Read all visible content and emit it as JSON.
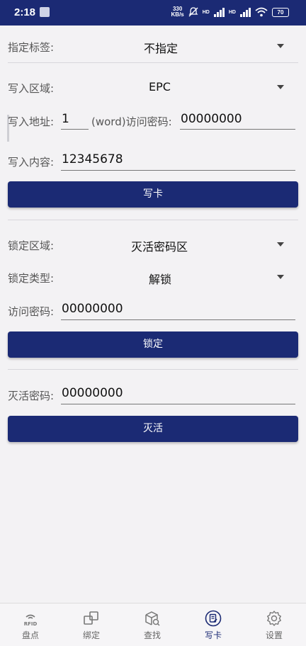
{
  "status": {
    "time": "2:18",
    "speed_top": "330",
    "speed_bottom": "KB/s",
    "network_1": "HD",
    "network_2": "HD",
    "battery": "70"
  },
  "write": {
    "tag_label": "指定标签:",
    "tag_value": "不指定",
    "area_label": "写入区域:",
    "area_value": "EPC",
    "address_label": "写入地址:",
    "address_value": "1",
    "word_label": "(word)访问密码:",
    "password_value": "00000000",
    "content_label": "写入内容:",
    "content_value": "12345678",
    "button": "写卡"
  },
  "lock": {
    "area_label": "锁定区域:",
    "area_value": "灭活密码区",
    "type_label": "锁定类型:",
    "type_value": "解锁",
    "password_label": "访问密码:",
    "password_value": "00000000",
    "button": "锁定"
  },
  "kill": {
    "password_label": "灭活密码:",
    "password_value": "00000000",
    "button": "灭活"
  },
  "nav": {
    "items": [
      {
        "label": "盘点",
        "icon": "rfid-icon",
        "icon_text": "RFID"
      },
      {
        "label": "绑定",
        "icon": "bind-icon"
      },
      {
        "label": "查找",
        "icon": "search-box-icon"
      },
      {
        "label": "写卡",
        "icon": "write-card-icon"
      },
      {
        "label": "设置",
        "icon": "gear-icon"
      }
    ],
    "active_index": 3
  },
  "colors": {
    "primary": "#1b2a74",
    "background": "#f3f2f4"
  }
}
